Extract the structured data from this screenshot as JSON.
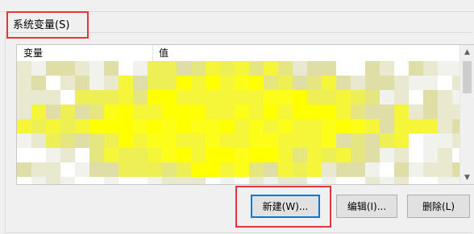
{
  "section": {
    "title": "系统变量(S)"
  },
  "table": {
    "columns": [
      "变量",
      "值"
    ],
    "content_state": "blurred"
  },
  "buttons": {
    "new_label": "新建(W)...",
    "edit_label": "编辑(I)...",
    "delete_label": "删除(L)"
  },
  "colors": {
    "annotation_red": "#e3353a",
    "focus_blue": "#0078d7",
    "blur_yellow": "#ffff00"
  },
  "icons": {
    "scroll_up": "scroll-up-arrow-icon",
    "scroll_down": "scroll-down-arrow-icon"
  }
}
